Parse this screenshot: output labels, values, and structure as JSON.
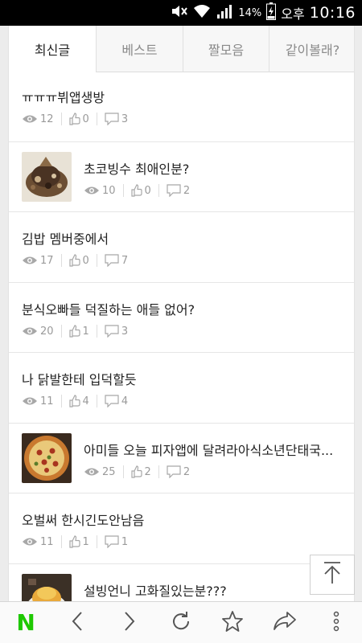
{
  "status_bar": {
    "battery_percent": "14%",
    "ampm": "오후",
    "time": "10:16"
  },
  "tabs": [
    {
      "label": "최신글",
      "active": true
    },
    {
      "label": "베스트",
      "active": false
    },
    {
      "label": "짤모음",
      "active": false
    },
    {
      "label": "같이볼래?",
      "active": false
    }
  ],
  "posts": [
    {
      "title": "ㅠㅠㅠ뷔앱생방",
      "views": "12",
      "likes": "0",
      "comments": "3",
      "thumbnail": null
    },
    {
      "title": "초코빙수 최애인분?",
      "views": "10",
      "likes": "0",
      "comments": "2",
      "thumbnail": "choco-bingsu"
    },
    {
      "title": "김밥 멤버중에서",
      "views": "17",
      "likes": "0",
      "comments": "7",
      "thumbnail": null
    },
    {
      "title": "분식오빠들 덕질하는 애들 없어?",
      "views": "20",
      "likes": "1",
      "comments": "3",
      "thumbnail": null
    },
    {
      "title": "나 닭발한테 입덕할듯",
      "views": "11",
      "likes": "4",
      "comments": "4",
      "thumbnail": null
    },
    {
      "title": "아미들 오늘 피자앱에 달려라아식소년단태국...",
      "views": "25",
      "likes": "2",
      "comments": "2",
      "thumbnail": "pizza"
    },
    {
      "title": "오벌써 한시긴도안남음",
      "views": "11",
      "likes": "1",
      "comments": "1",
      "thumbnail": null
    },
    {
      "title": "설빙언니 고화질있는분???",
      "views": "",
      "likes": "",
      "comments": "",
      "thumbnail": "bingsu"
    }
  ],
  "bottom_bar": {
    "logo": "N",
    "buttons": [
      "back-icon",
      "forward-icon",
      "refresh-icon",
      "star-icon",
      "share-icon",
      "more-icon"
    ]
  },
  "colors": {
    "accent": "#1ec800",
    "text": "#222222",
    "muted": "#9a9a9a"
  }
}
